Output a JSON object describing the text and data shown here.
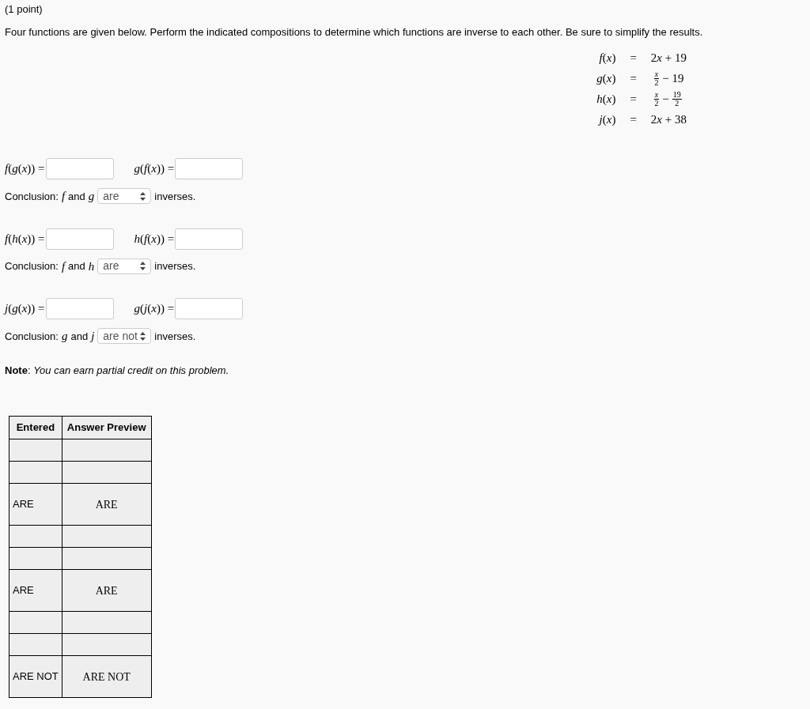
{
  "points": "(1 point)",
  "instructions": "Four functions are given below. Perform the indicated compositions to determine which functions are inverse to each other. Be sure to simplify the results.",
  "definitions": [
    {
      "lhs": "*f*(*x*)",
      "eq": "=",
      "rhs": [
        {
          "kind": "text",
          "text": "2"
        },
        {
          "kind": "var",
          "text": "x"
        },
        {
          "kind": "text",
          "text": " + 19"
        }
      ]
    },
    {
      "lhs": "*g*(*x*)",
      "eq": "=",
      "rhs": [
        {
          "kind": "frac",
          "num": "*x*",
          "den": "2"
        },
        {
          "kind": "text",
          "text": "− 19"
        }
      ]
    },
    {
      "lhs": "*h*(*x*)",
      "eq": "=",
      "rhs": [
        {
          "kind": "frac",
          "num": "*x*",
          "den": "2"
        },
        {
          "kind": "text",
          "text": "−"
        },
        {
          "kind": "frac",
          "num": "19",
          "den": "2"
        }
      ]
    },
    {
      "lhs": "*j*(*x*)",
      "eq": "=",
      "rhs": [
        {
          "kind": "text",
          "text": "2"
        },
        {
          "kind": "var",
          "text": "x"
        },
        {
          "kind": "text",
          "text": " + 38"
        }
      ]
    }
  ],
  "problems": [
    {
      "left_label": "*f*(*g*(*x*)) =",
      "right_label": "*g*(*f*(*x*)) =",
      "conclusion": {
        "prefix": "Conclusion:",
        "first": "f",
        "and": "and",
        "second": "g",
        "choice": "are",
        "suffix": "inverses."
      }
    },
    {
      "left_label": "*f*(*h*(*x*)) =",
      "right_label": "*h*(*f*(*x*)) =",
      "conclusion": {
        "prefix": "Conclusion:",
        "first": "f",
        "and": "and",
        "second": "h",
        "choice": "are",
        "suffix": "inverses."
      }
    },
    {
      "left_label": "*j*(*g*(*x*)) =",
      "right_label": "*g*(*j*(*x*)) =",
      "conclusion": {
        "prefix": "Conclusion:",
        "first": "g",
        "and": "and",
        "second": "j",
        "choice": "are not",
        "suffix": "inverses."
      }
    }
  ],
  "note": "**Note**: *You can earn partial credit on this problem.*",
  "table": {
    "columns": [
      "Entered",
      "Answer Preview"
    ],
    "rows": [
      {
        "kind": "blank"
      },
      {
        "kind": "blank"
      },
      {
        "kind": "answer",
        "entered": "ARE",
        "preview": "ARE"
      },
      {
        "kind": "blank"
      },
      {
        "kind": "blank"
      },
      {
        "kind": "answer",
        "entered": "ARE",
        "preview": "ARE"
      },
      {
        "kind": "blank"
      },
      {
        "kind": "blank"
      },
      {
        "kind": "answer",
        "entered": "ARE NOT",
        "preview": "ARE NOT"
      }
    ]
  }
}
